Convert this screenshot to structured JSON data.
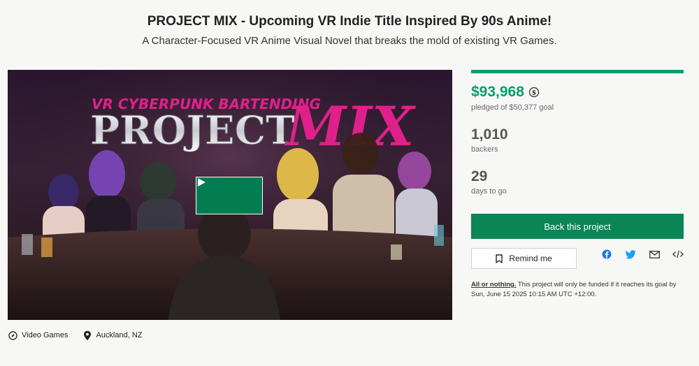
{
  "header": {
    "title": "PROJECT MIX - Upcoming VR Indie Title Inspired By 90s Anime!",
    "subtitle": "A Character-Focused VR Anime Visual Novel that breaks the mold of existing VR Games."
  },
  "media": {
    "banner_top": "VR CYBERPUNK BARTENDING",
    "banner_main": "PROJECT",
    "banner_accent": "MIX",
    "play_icon": "play-icon"
  },
  "meta": {
    "category": "Video Games",
    "location": "Auckland, NZ"
  },
  "stats": {
    "funded_fraction": 1.0,
    "pledged": "$93,968",
    "pledged_label": "pledged of $50,377 goal",
    "backers": "1,010",
    "backers_label": "backers",
    "days": "29",
    "days_label": "days to go"
  },
  "actions": {
    "back_label": "Back this project",
    "remind_label": "Remind me",
    "share_icons": [
      "facebook-icon",
      "twitter-icon",
      "email-icon",
      "embed-icon"
    ]
  },
  "fine_print": {
    "aon": "All or nothing.",
    "text": " This project will only be funded if it reaches its goal by Sun, June 15 2025 10:15 AM UTC +12:00."
  },
  "colors": {
    "accent_green": "#05a068",
    "button_green": "#0b8456",
    "banner_pink": "#e0208a"
  }
}
